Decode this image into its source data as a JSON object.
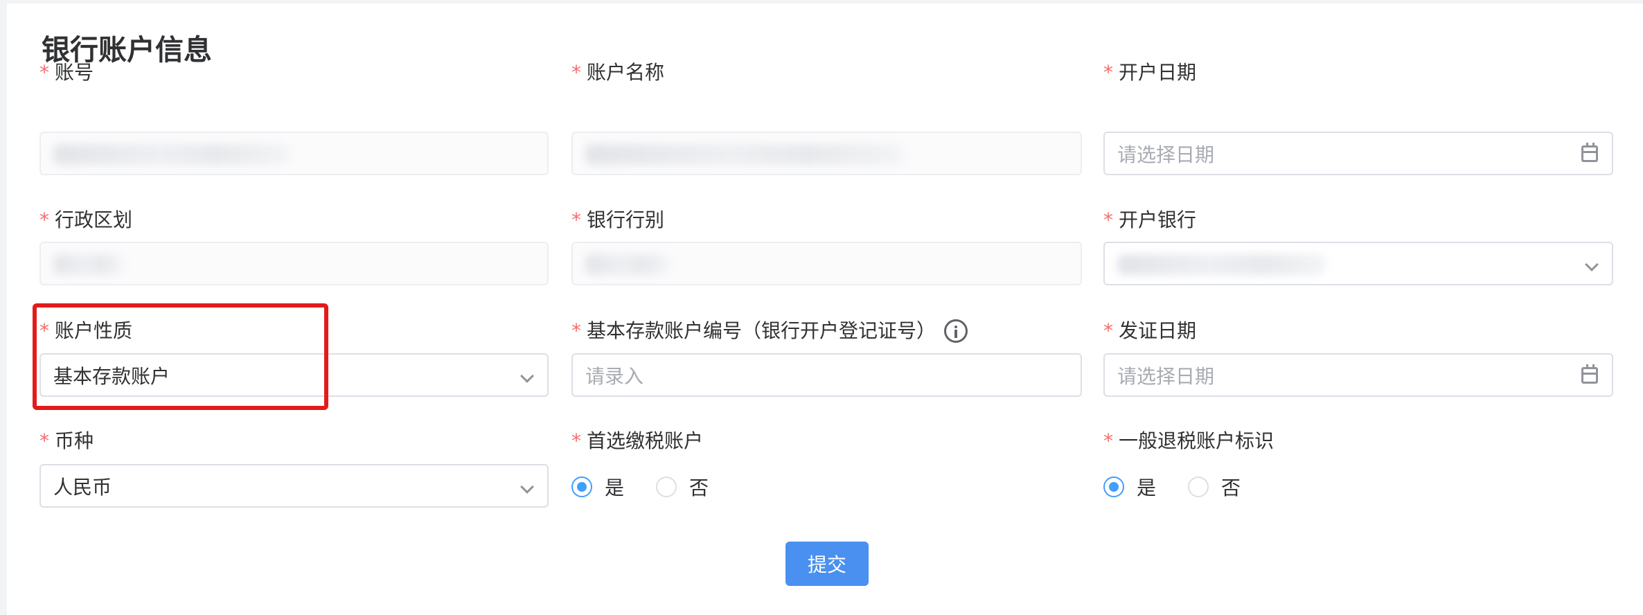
{
  "section_title": "银行账户信息",
  "required_mark": "*",
  "fields": {
    "account_no": {
      "label": "账号"
    },
    "account_name": {
      "label": "账户名称"
    },
    "open_date": {
      "label": "开户日期",
      "placeholder": "请选择日期"
    },
    "admin_region": {
      "label": "行政区划"
    },
    "bank_type": {
      "label": "银行行别"
    },
    "open_bank": {
      "label": "开户银行"
    },
    "account_nature": {
      "label": "账户性质",
      "value": "基本存款账户"
    },
    "basic_account_no": {
      "label": "基本存款账户编号（银行开户登记证号）",
      "placeholder": "请录入"
    },
    "issue_date": {
      "label": "发证日期",
      "placeholder": "请选择日期"
    },
    "currency": {
      "label": "币种",
      "value": "人民币"
    },
    "preferred_tax_account": {
      "label": "首选缴税账户",
      "options": [
        "是",
        "否"
      ],
      "selected": "是"
    },
    "general_refund_flag": {
      "label": "一般退税账户标识",
      "options": [
        "是",
        "否"
      ],
      "selected": "是"
    }
  },
  "submit_label": "提交",
  "colors": {
    "primary": "#409eff",
    "button": "#4a90f0",
    "required": "#f56c6c",
    "highlight": "#e31b1b"
  },
  "icons": {
    "date_picker": "calendar-icon",
    "select": "chevron-down-icon",
    "help": "info-circle-icon"
  }
}
